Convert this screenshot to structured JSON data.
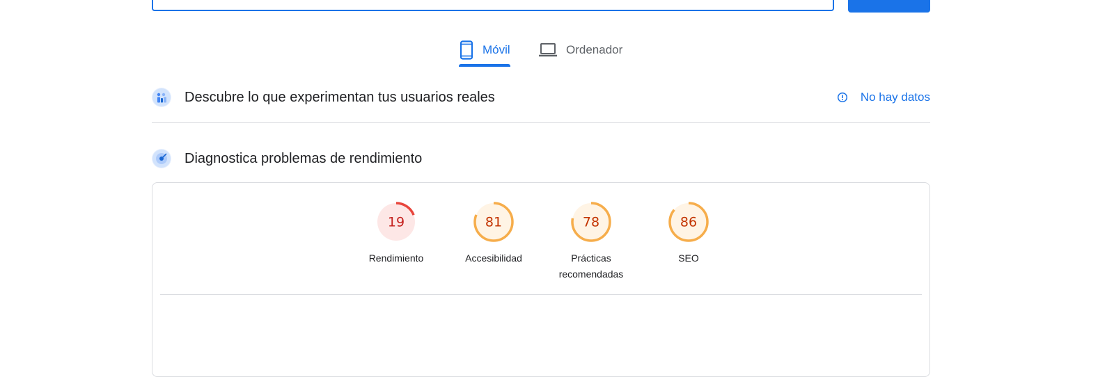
{
  "tabs": [
    {
      "label": "Móvil",
      "icon": "smartphone-icon",
      "active": true
    },
    {
      "label": "Ordenador",
      "icon": "laptop-icon",
      "active": false
    }
  ],
  "field_data": {
    "title": "Descubre lo que experimentan tus usuarios reales",
    "icon": "field-data-icon",
    "status": "No hay datos",
    "status_icon": "info-icon"
  },
  "lab_data": {
    "title": "Diagnostica problemas de rendimiento",
    "icon": "lab-data-icon"
  },
  "scores": [
    {
      "value": 19,
      "label": "Rendimiento",
      "color": "#e8453c",
      "bg": "#fde7e6",
      "text": "#c5221f"
    },
    {
      "value": 81,
      "label": "Accesibilidad",
      "color": "#f6ad4b",
      "bg": "#fff4e5",
      "text": "#c33300"
    },
    {
      "value": 78,
      "label": "Prácticas recomendadas",
      "color": "#f6ad4b",
      "bg": "#fff4e5",
      "text": "#c33300"
    },
    {
      "value": 86,
      "label": "SEO",
      "color": "#f6ad4b",
      "bg": "#fff4e5",
      "text": "#c33300"
    }
  ],
  "colors": {
    "accent": "#1a73e8",
    "divider": "#dadce0"
  }
}
